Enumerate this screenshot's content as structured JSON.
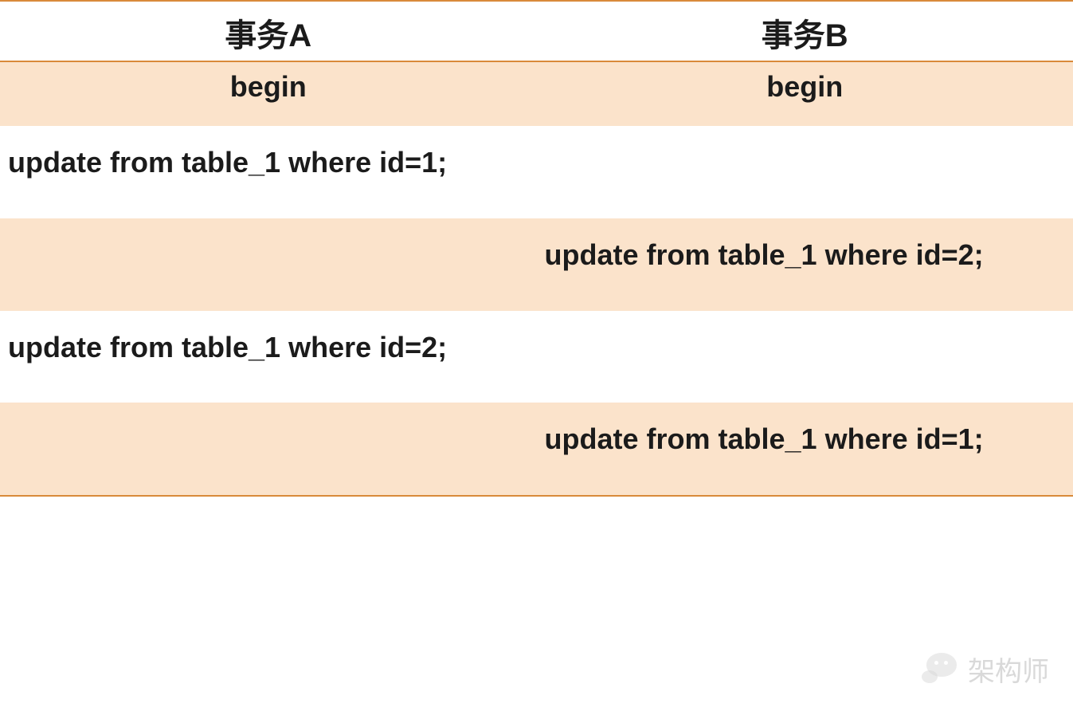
{
  "chart_data": {
    "type": "table",
    "columns": [
      "事务A",
      "事务B"
    ],
    "rows": [
      [
        "begin",
        "begin"
      ],
      [
        "update from table_1 where id=1;",
        ""
      ],
      [
        "",
        "update from table_1 where id=2;"
      ],
      [
        "update from table_1 where id=2;",
        ""
      ],
      [
        "",
        "update from table_1 where id=1;"
      ]
    ]
  },
  "header": {
    "col_a": "事务A",
    "col_b": "事务B"
  },
  "rows": {
    "r1": {
      "a": "begin",
      "b": "begin"
    },
    "r2": {
      "a": "update from table_1 where id=1;",
      "b": ""
    },
    "r3": {
      "a": "",
      "b": "update from table_1 where id=2;"
    },
    "r4": {
      "a": "update from table_1 where id=2;",
      "b": ""
    },
    "r5": {
      "a": "",
      "b": "update from table_1 where id=1;"
    }
  },
  "watermark": {
    "label": "架构师"
  }
}
